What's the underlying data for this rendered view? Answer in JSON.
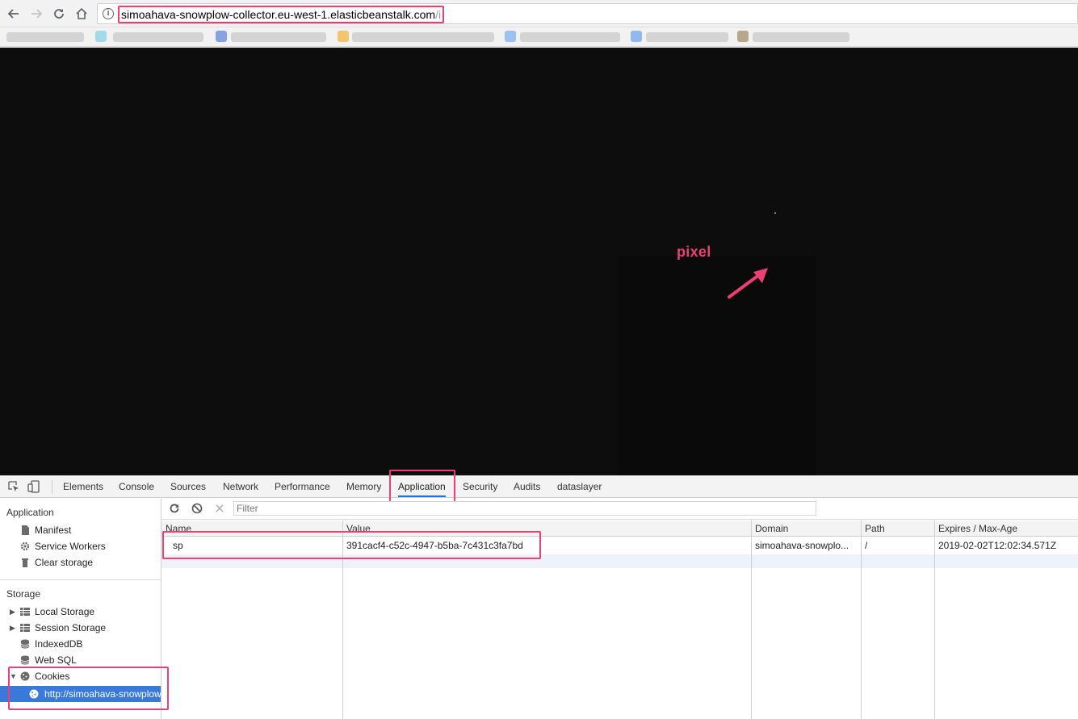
{
  "browser": {
    "url_host": "simoahava-snowplow-collector.eu-west-1.elasticbeanstalk.com",
    "url_path": "/i",
    "back_icon": "arrow-left-icon",
    "forward_icon": "arrow-right-icon",
    "reload_icon": "reload-icon",
    "home_icon": "home-icon",
    "info_icon": "info-icon"
  },
  "page": {
    "annotation_label": "pixel",
    "accent": "#ec3f73"
  },
  "devtools": {
    "tabs": [
      "Elements",
      "Console",
      "Sources",
      "Network",
      "Performance",
      "Memory",
      "Application",
      "Security",
      "Audits",
      "dataslayer"
    ],
    "active_tab": "Application",
    "sidebar": {
      "application_header": "Application",
      "application_items": [
        "Manifest",
        "Service Workers",
        "Clear storage"
      ],
      "storage_header": "Storage",
      "storage_items": [
        "Local Storage",
        "Session Storage",
        "IndexedDB",
        "Web SQL",
        "Cookies"
      ],
      "selected_cookie": "http://simoahava-snowplow"
    },
    "filter_placeholder": "Filter",
    "columns": [
      "Name",
      "Value",
      "Domain",
      "Path",
      "Expires / Max-Age"
    ],
    "rows": [
      {
        "name": "sp",
        "value": "391cacf4-c52c-4947-b5ba-7c431c3fa7bd",
        "domain": "simoahava-snowplo...",
        "path": "/",
        "expires": "2019-02-02T12:02:34.571Z"
      }
    ]
  }
}
